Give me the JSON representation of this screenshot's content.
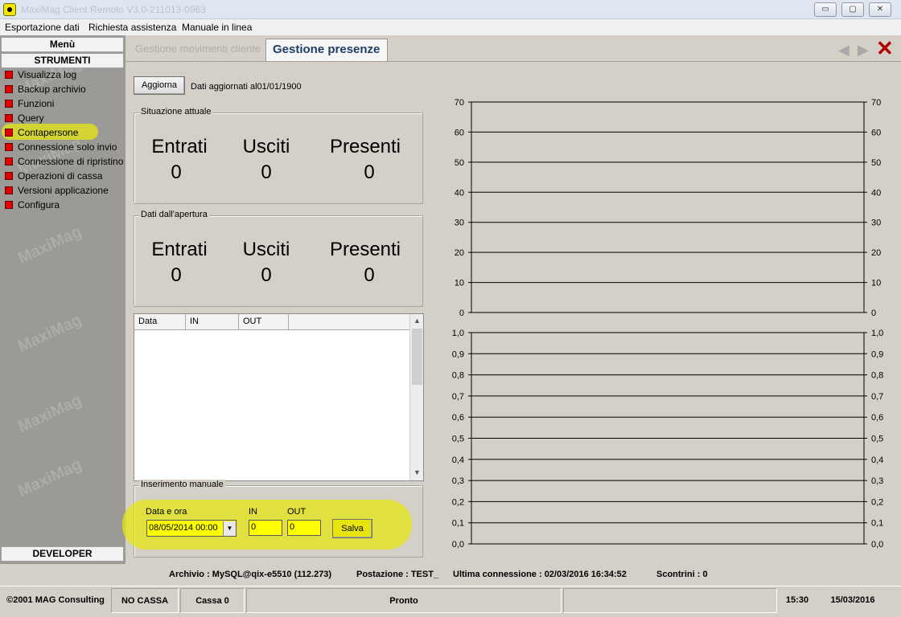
{
  "window": {
    "title": "MaxiMag Client Remoto V3.0-211013-0963",
    "controls": {
      "minimize": "▭",
      "maximize": "▢",
      "close": "✕"
    }
  },
  "menubar": [
    "Esportazione dati",
    "Richiesta assistenza",
    "Manuale in linea"
  ],
  "sidebar": {
    "menu_label": "Menù",
    "section_label": "STRUMENTI",
    "items": [
      "Visualizza log",
      "Backup archivio",
      "Funzioni",
      "Query",
      "Contapersone",
      "Connessione solo invio",
      "Connessione di ripristino",
      "Operazioni di cassa",
      "Versioni applicazione",
      "Configura"
    ],
    "selected": "Contapersone",
    "watermark": "MaxiMag",
    "developer_label": "DEVELOPER"
  },
  "tabs": [
    {
      "label": "Gestione movimenti cliente",
      "active": false
    },
    {
      "label": "Gestione presenze",
      "active": true
    }
  ],
  "nav": {
    "prev": "◀",
    "next": "▶",
    "close": "✕"
  },
  "toolbar": {
    "refresh_label": "Aggiorna",
    "updated_text": "Dati aggiornati al01/01/1900"
  },
  "current": {
    "title": "Situazione attuale",
    "entrati_label": "Entrati",
    "usciti_label": "Usciti",
    "presenti_label": "Presenti",
    "entrati": "0",
    "usciti": "0",
    "presenti": "0"
  },
  "since_open": {
    "title": "Dati dall'apertura",
    "entrati_label": "Entrati",
    "usciti_label": "Usciti",
    "presenti_label": "Presenti",
    "entrati": "0",
    "usciti": "0",
    "presenti": "0"
  },
  "list": {
    "columns": [
      "Data",
      "IN",
      "OUT"
    ],
    "rows": []
  },
  "manual": {
    "title": "Inserimento manuale",
    "date_label": "Data e ora",
    "date_value": "08/05/2014 00:00",
    "in_label": "IN",
    "in_value": "0",
    "out_label": "OUT",
    "out_value": "0",
    "save_label": "Salva"
  },
  "chart_data": [
    {
      "type": "line",
      "ylim": [
        0,
        70
      ],
      "yticks": [
        "0",
        "10",
        "20",
        "30",
        "40",
        "50",
        "60",
        "70"
      ],
      "grid": true,
      "series": []
    },
    {
      "type": "line",
      "ylim": [
        0,
        1
      ],
      "yticks": [
        "0,0",
        "0,1",
        "0,2",
        "0,3",
        "0,4",
        "0,5",
        "0,6",
        "0,7",
        "0,8",
        "0,9",
        "1,0"
      ],
      "grid": true,
      "series": []
    }
  ],
  "infobar": {
    "archivio": "Archivio : MySQL@qix-e5510 (112.273)",
    "postazione": "Postazione : TEST_",
    "ultima": "Ultima connessione : 02/03/2016 16:34:52",
    "scontrini": "Scontrini : 0"
  },
  "status": {
    "copyright": "©2001 MAG Consulting",
    "cassa_mode": "NO CASSA",
    "cassa": "Cassa 0",
    "state": "Pronto",
    "extra": "",
    "time": "15:30",
    "date": "15/03/2016"
  },
  "colors": {
    "highlight": "#e6e614",
    "input_bg": "#ffff00",
    "tab_active_text": "#1f3e68",
    "close_red": "#b00000"
  }
}
